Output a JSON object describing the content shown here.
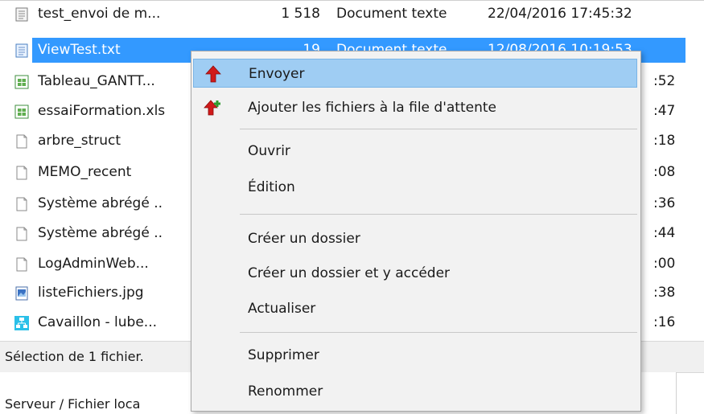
{
  "files": [
    {
      "name": "test_envoi de m...",
      "size": "1 518",
      "type": "Document texte",
      "date": "22/04/2016 17:45:32",
      "icon": "text-document-icon"
    },
    {
      "name": "ViewTest.txt",
      "size": "19",
      "type": "Document texte",
      "date": "12/08/2016 10:19:53",
      "icon": "text-document-icon",
      "selected": true
    },
    {
      "name": "Tableau_GANTT...",
      "fragment": ":52",
      "icon": "spreadsheet-icon"
    },
    {
      "name": "essaiFormation.xls",
      "fragment": ":47",
      "icon": "spreadsheet-icon"
    },
    {
      "name": "arbre_struct",
      "fragment": ":18",
      "icon": "blank-file-icon"
    },
    {
      "name": "MEMO_recent",
      "fragment": ":08",
      "icon": "blank-file-icon"
    },
    {
      "name": "Système abrégé ..",
      "fragment": ":36",
      "icon": "blank-file-icon"
    },
    {
      "name": "Système abrégé ..",
      "fragment": ":44",
      "icon": "blank-file-icon"
    },
    {
      "name": "LogAdminWeb...",
      "fragment": ":00",
      "icon": "blank-file-icon"
    },
    {
      "name": "listeFichiers.jpg",
      "fragment": ":38",
      "icon": "image-file-icon"
    },
    {
      "name": "Cavaillon -  lube...",
      "fragment": ":16",
      "icon": "network-diagram-icon"
    }
  ],
  "status": {
    "text": "Sélection de 1 fichier."
  },
  "bottom_tab": {
    "label": "Serveur / Fichier loca"
  },
  "context_menu": {
    "items": [
      {
        "label": "Envoyer",
        "icon": "upload-arrow-icon",
        "highlighted": true
      },
      {
        "label": "Ajouter les fichiers à la file d'attente",
        "icon": "add-to-queue-icon"
      },
      {
        "separator": true
      },
      {
        "label": "Ouvrir"
      },
      {
        "label": "Édition"
      },
      {
        "separator": true
      },
      {
        "label": "Créer un dossier"
      },
      {
        "label": "Créer un dossier et y accéder"
      },
      {
        "label": "Actualiser"
      },
      {
        "separator": true
      },
      {
        "label": "Supprimer"
      },
      {
        "label": "Renommer"
      }
    ]
  },
  "colors": {
    "selection": "#3399ff",
    "menu_highlight": "#9fcdf3",
    "menu_bg": "#f2f2f2",
    "status_bg": "#f0f0f0"
  }
}
